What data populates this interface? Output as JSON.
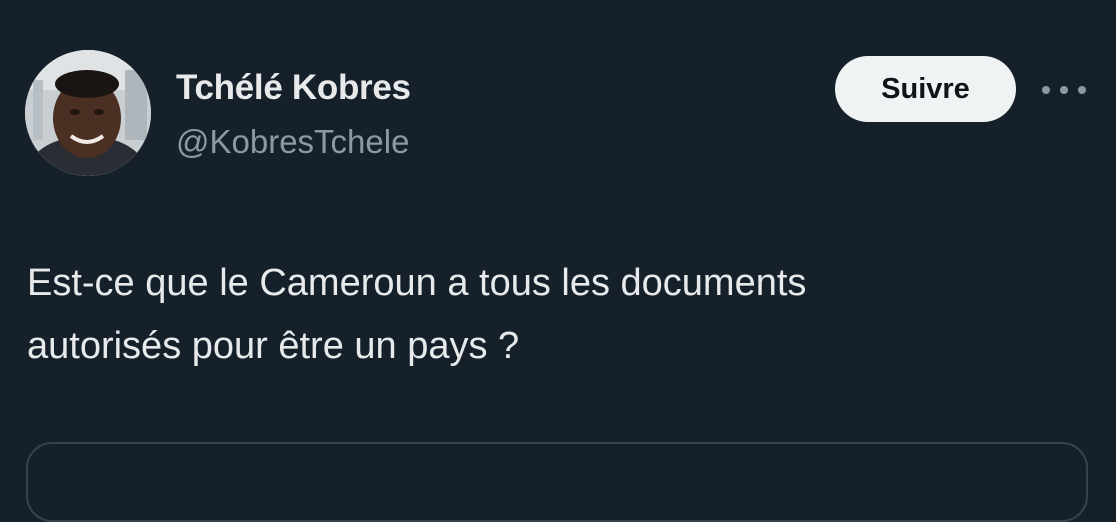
{
  "author": {
    "display_name": "Tchélé Kobres",
    "handle": "@KobresTchele"
  },
  "actions": {
    "follow_label": "Suivre",
    "more_icon": "more-horizontal-icon"
  },
  "tweet": {
    "text_lines": [
      "Est-ce que le Cameroun a tous les documents",
      "autorisés pour être un pays ?"
    ]
  },
  "colors": {
    "background": "#15202b",
    "primary_text": "#e7e9ea",
    "secondary_text": "#8b98a5",
    "follow_button_bg": "#eff3f4",
    "follow_button_text": "#0f1419",
    "border": "#38444d"
  }
}
